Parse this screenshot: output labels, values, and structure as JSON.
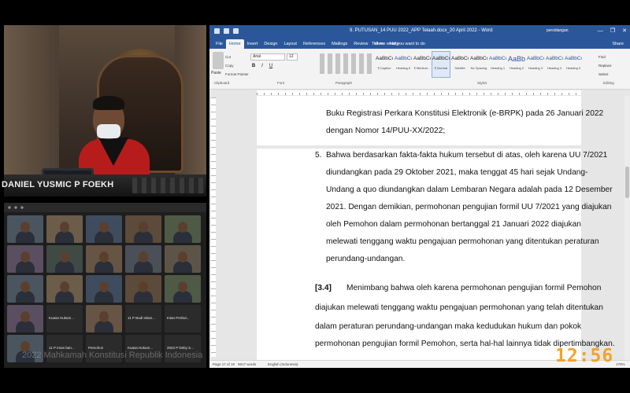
{
  "judge_video": {
    "nameplate": "DANIEL YUSMIC P FOEKH"
  },
  "participants": [
    {
      "label": ""
    },
    {
      "label": ""
    },
    {
      "label": ""
    },
    {
      "label": ""
    },
    {
      "label": ""
    },
    {
      "label": ""
    },
    {
      "label": ""
    },
    {
      "label": ""
    },
    {
      "label": ""
    },
    {
      "label": ""
    },
    {
      "label": ""
    },
    {
      "label": ""
    },
    {
      "label": ""
    },
    {
      "label": ""
    },
    {
      "label": ""
    },
    {
      "label": ""
    },
    {
      "label": "Kuasa Hukum..."
    },
    {
      "label": ""
    },
    {
      "label": "11 P Budi Iskan..."
    },
    {
      "label": "Intan Pertiwi..."
    },
    {
      "label": ""
    },
    {
      "label": "11 P Iman ban..."
    },
    {
      "label": "Pemohon"
    },
    {
      "label": "Kuasa Hukum..."
    },
    {
      "label": "2022 P Deby S..."
    }
  ],
  "watermark": "2022 Mahkamah Konstitusi Republik Indonesia",
  "word": {
    "title": "9. PUTUSAN_14 PUU 2022_APP Telaah.docx_20 April 2022  -  Word",
    "user": "persidangan",
    "window_buttons": [
      "—",
      "❐",
      "✕"
    ],
    "tabs": [
      "File",
      "Home",
      "Insert",
      "Design",
      "Layout",
      "References",
      "Mailings",
      "Review",
      "View",
      "Help"
    ],
    "active_tab": "Home",
    "tell_me": "Tell me what you want to do",
    "share": "Share",
    "clipboard": {
      "paste": "Paste",
      "cut": "Cut",
      "copy": "Copy",
      "format_painter": "Format Painter"
    },
    "font": {
      "name": "Arial",
      "size": "12",
      "bold": "B",
      "italic": "I",
      "underline": "U"
    },
    "groups": {
      "clipboard": "Clipboard",
      "font": "Font",
      "paragraph": "Paragraph",
      "styles": "Styles",
      "editing": "Editing"
    },
    "styles": [
      {
        "preview": "AaBbCcDc",
        "name": "¶ Caption"
      },
      {
        "preview": "AaBbCc",
        "name": "Heading 6"
      },
      {
        "preview": "AaBbCcDd",
        "name": "¶ Medium..."
      },
      {
        "preview": "AaBbCcDd",
        "name": "¶ Normal",
        "selected": true
      },
      {
        "preview": "AaBbCcI",
        "name": "Subtitle"
      },
      {
        "preview": "AaBbCcDd",
        "name": "No Spacing"
      },
      {
        "preview": "AaBbCc",
        "name": "Heading 1"
      },
      {
        "preview": "AaBb",
        "name": "Heading 2"
      },
      {
        "preview": "AaBbCcl",
        "name": "Heading 3"
      },
      {
        "preview": "AaBbCcl",
        "name": "Heading 4"
      },
      {
        "preview": "AaBbCcl",
        "name": "Heading 5"
      }
    ],
    "editing": {
      "find": "Find",
      "replace": "Replace",
      "select": "Select"
    },
    "document_lines": [
      "Buku Registrasi Perkara Konstitusi Elektronik (e-BRPK) pada 26 Januari 2022",
      "dengan Nomor 14/PUU-XX/2022;",
      "5.",
      "Bahwa berdasarkan fakta-fakta hukum tersebut di atas, oleh karena UU 7/2021",
      "diundangkan pada 29 Oktober 2021, maka tenggat 45 hari sejak Undang-",
      "Undang a quo diundangkan dalam Lembaran Negara adalah pada 12 Desember",
      "2021. Dengan demikian, permohonan pengujian formil UU 7/2021 yang diajukan",
      "oleh Pemohon dalam permohonan bertanggal 21 Januari 2022 diajukan",
      "melewati tenggang waktu pengajuan permohonan yang ditentukan peraturan",
      "perundang-undangan.",
      "[3.4]",
      "Menimbang bahwa oleh karena permohonan pengujian formil Pemohon",
      "diajukan melewati tenggang waktu pengajuan permohonan yang telah ditentukan",
      "dalam peraturan perundang-undangan maka kedudukan hukum dan pokok",
      "permohonan pengujian formil Pemohon, serta hal-hal lainnya tidak dipertimbangkan."
    ],
    "status": {
      "page": "Page 17 of 19",
      "words": "9617 words",
      "language": "English (Indonesia)",
      "zoom": "170%"
    }
  },
  "clock": "12:56"
}
